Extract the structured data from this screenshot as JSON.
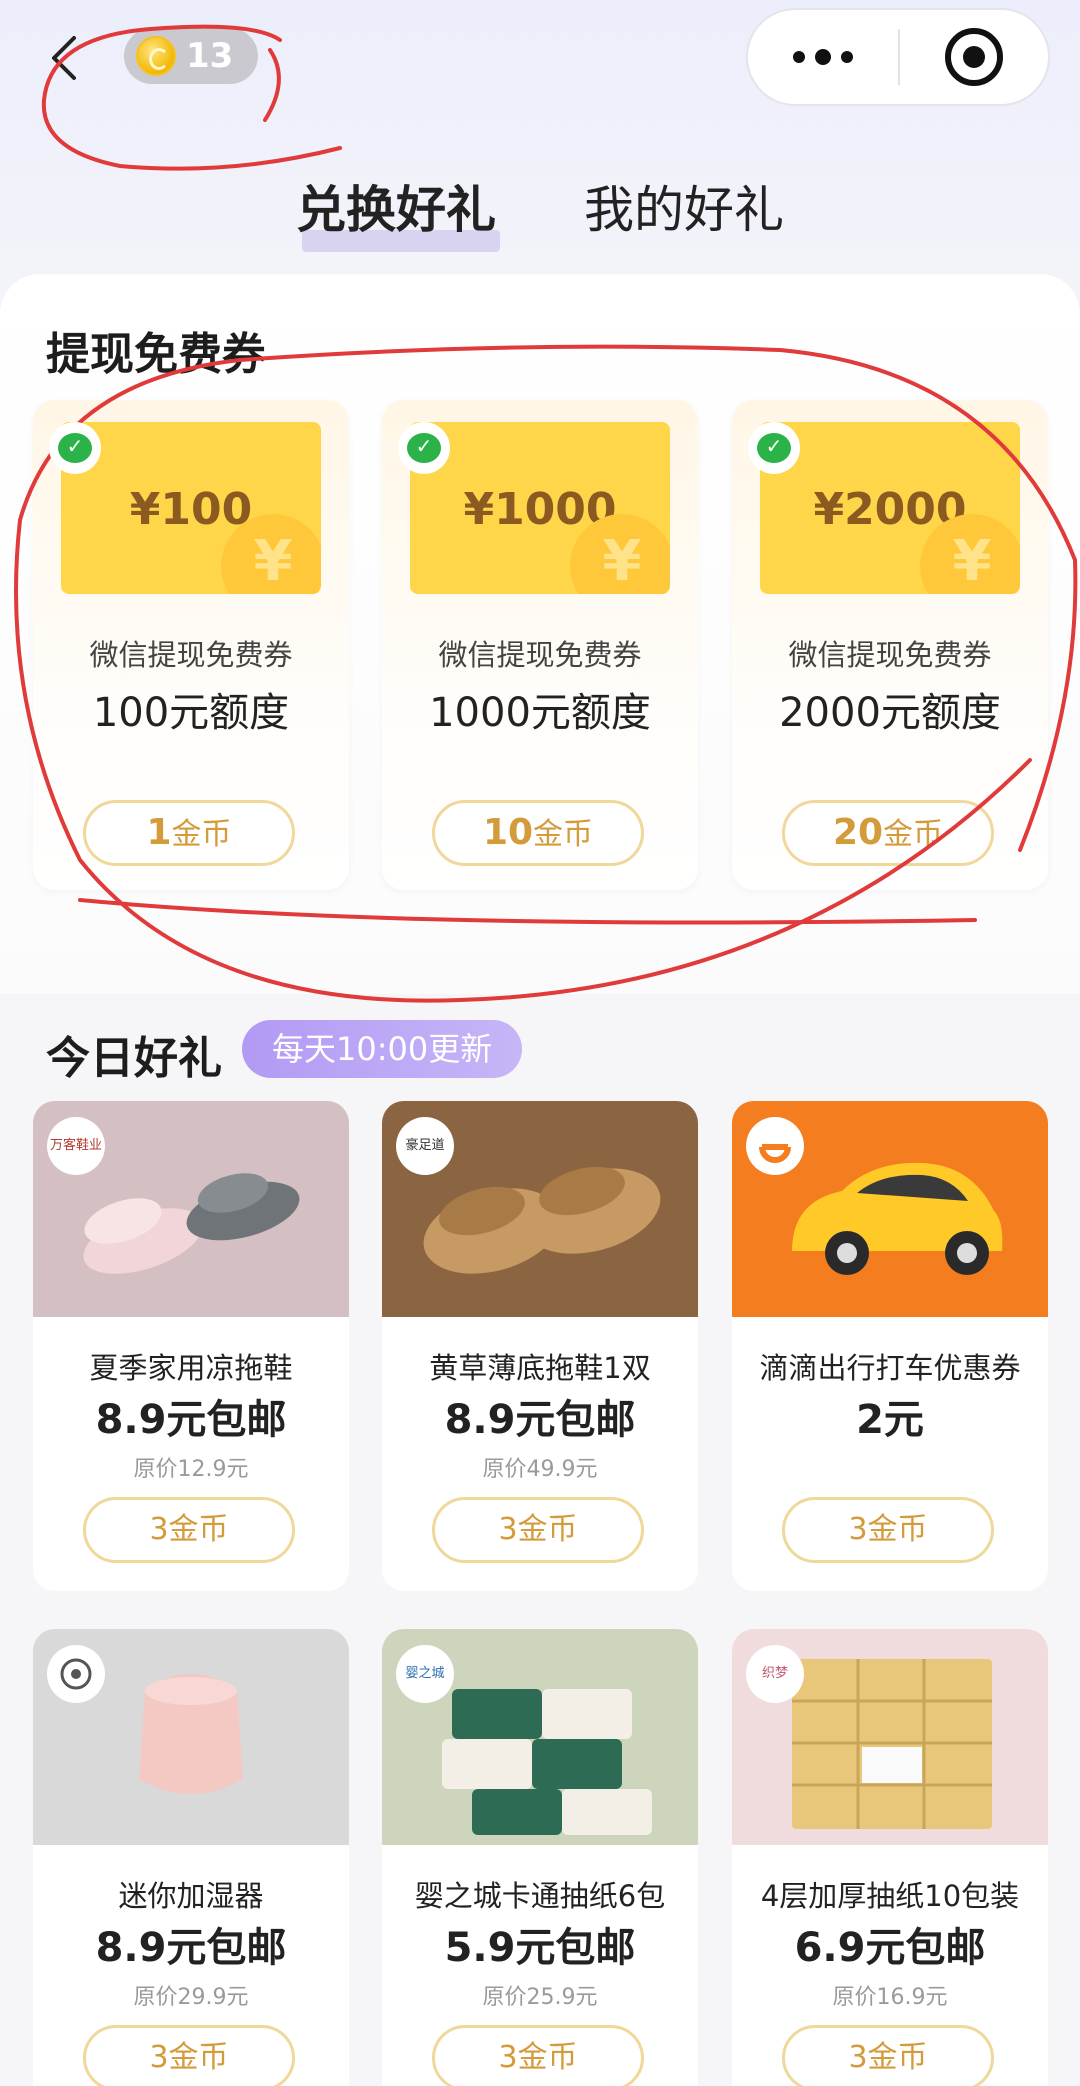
{
  "header": {
    "coin_balance": "13",
    "tabs": [
      {
        "label": "兑换好礼",
        "active": true
      },
      {
        "label": "我的好礼",
        "active": false
      }
    ]
  },
  "voucher_section": {
    "title": "提现免费券",
    "cards": [
      {
        "amount": "¥100",
        "subtitle": "微信提现免费券",
        "quota": "100元额度",
        "price_num": "1",
        "price_unit": "金币"
      },
      {
        "amount": "¥1000",
        "subtitle": "微信提现免费券",
        "quota": "1000元额度",
        "price_num": "10",
        "price_unit": "金币"
      },
      {
        "amount": "¥2000",
        "subtitle": "微信提现免费券",
        "quota": "2000元额度",
        "price_num": "20",
        "price_unit": "金币"
      }
    ],
    "yen_symbol": "¥"
  },
  "today_section": {
    "title": "今日好礼",
    "badge": "每天10:00更新",
    "items": [
      {
        "name": "夏季家用凉拖鞋",
        "price": "8.9元包邮",
        "original": "原价12.9元",
        "cost": "3金币",
        "brand": "万客鞋业",
        "image": "slippers-pink-gray",
        "bg": "#d4bfc3"
      },
      {
        "name": "黄草薄底拖鞋1双",
        "price": "8.9元包邮",
        "original": "原价49.9元",
        "cost": "3金币",
        "brand": "豪足道",
        "image": "straw-slippers",
        "bg": "#8b6541"
      },
      {
        "name": "滴滴出行打车优惠券",
        "price": "2元",
        "original": "",
        "cost": "3金币",
        "brand": "didi-logo",
        "image": "yellow-car",
        "bg": "#f47d20"
      },
      {
        "name": "迷你加湿器",
        "price": "8.9元包邮",
        "original": "原价29.9元",
        "cost": "3金币",
        "brand": "humidifier-brand",
        "image": "pink-humidifier",
        "bg": "#d9d9d9"
      },
      {
        "name": "婴之城卡通抽纸6包",
        "price": "5.9元包邮",
        "original": "原价25.9元",
        "cost": "3金币",
        "brand": "婴之城",
        "image": "tissue-packs",
        "bg": "#cdd6bd"
      },
      {
        "name": "4层加厚抽纸10包装",
        "price": "6.9元包邮",
        "original": "原价16.9元",
        "cost": "3金币",
        "brand": "织梦",
        "image": "tissue-boxes",
        "bg": "#f0dcdc"
      }
    ]
  },
  "colors": {
    "accent_gold": "#d39b3a",
    "annotation_red": "#e03a3a",
    "voucher_yellow": "#ffd54a"
  }
}
